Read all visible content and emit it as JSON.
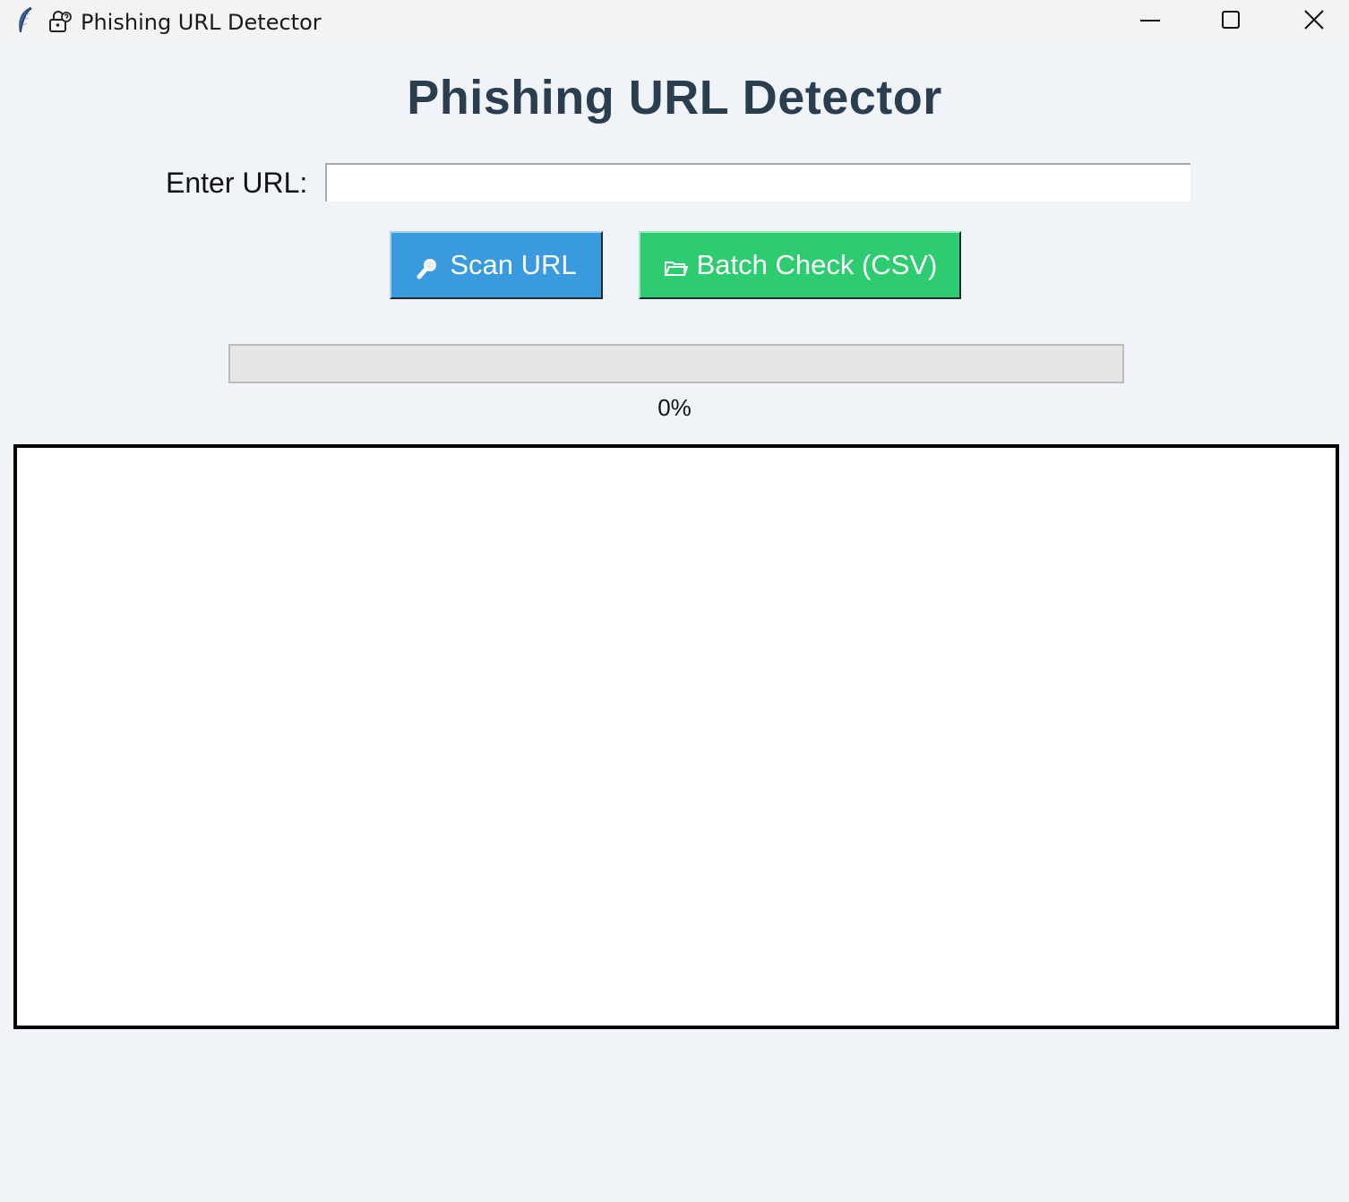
{
  "window": {
    "title": "Phishing URL Detector",
    "app_icon": "feather-icon",
    "title_icon": "lock-icon",
    "controls": [
      "minimize-icon",
      "maximize-icon",
      "close-icon"
    ]
  },
  "main": {
    "heading": "Phishing URL Detector",
    "url_label": "Enter URL:",
    "url_value": "",
    "scan_button": {
      "icon": "magnifier-icon",
      "label": "Scan URL",
      "color": "#3a9ade"
    },
    "batch_button": {
      "icon": "folder-icon",
      "label": "Batch Check (CSV)",
      "color": "#2ecc71"
    },
    "progress": {
      "value": 0,
      "text": "0%"
    },
    "results": ""
  },
  "colors": {
    "background": "#f0f3f8",
    "heading": "#2b3e50"
  }
}
